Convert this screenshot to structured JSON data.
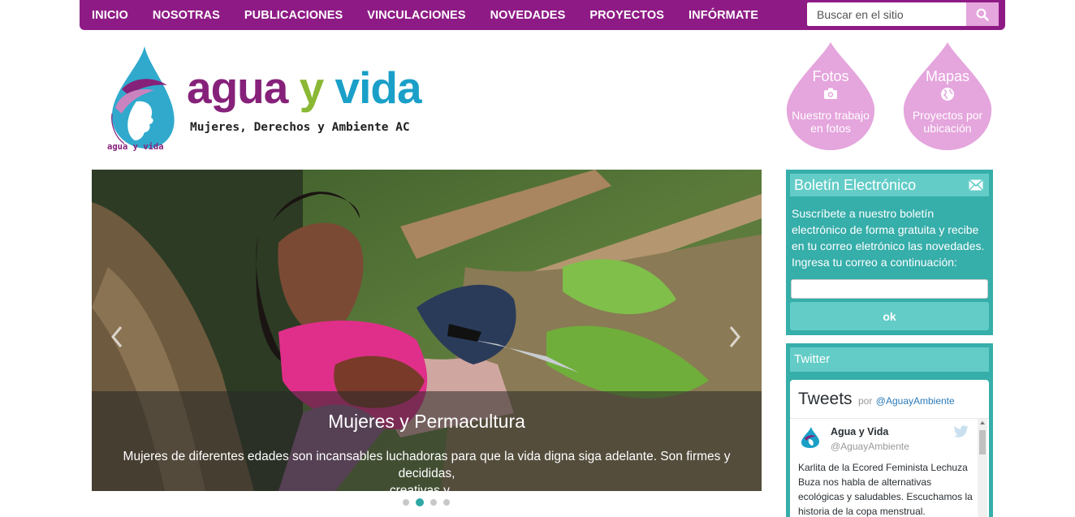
{
  "nav": {
    "items": [
      "INICIO",
      "NOSOTRAS",
      "PUBLICACIONES",
      "VINCULACIONES",
      "NOVEDADES",
      "PROYECTOS",
      "INFÓRMATE"
    ],
    "search_placeholder": "Buscar en el sitio",
    "accent": "#8e1b85"
  },
  "logo": {
    "word1": "agua",
    "word2": "y",
    "word3": "vida",
    "subtitle": "Mujeres, Derechos y Ambiente AC",
    "small": "agua y vida"
  },
  "drops": [
    {
      "title": "Fotos",
      "icon": "camera-icon",
      "desc_line1": "Nuestro trabajo",
      "desc_line2": "en fotos"
    },
    {
      "title": "Mapas",
      "icon": "globe-icon",
      "desc_line1": "Proyectos por",
      "desc_line2": "ubicación"
    }
  ],
  "carousel": {
    "title": "Mujeres y Permacultura",
    "text_line1": "Mujeres de diferentes edades son incansables luchadoras para que la vida digna siga adelante. Son firmes y decididas,",
    "text_line2": "creativas y ...",
    "slide_count": 4,
    "active_slide": 2
  },
  "newsletter": {
    "title": "Boletín Electrónico",
    "text": "Suscríbete a nuestro boletín electrónico de forma gratuita y recibe en tu correo eletrónico las novedades. Ingresa tu correo a continuación:",
    "button": "ok"
  },
  "twitter": {
    "title": "Twitter",
    "widget_title": "Tweets",
    "by": "por",
    "account": "@AguayAmbiente",
    "tweet": {
      "name": "Agua y Vida",
      "handle": "@AguayAmbiente",
      "text": "Karlita de la Ecored Feminista Lechuza Buza nos habla de alternativas ecológicas y saludables. Escuchamos la historia de la copa menstrual."
    }
  },
  "colors": {
    "purple": "#8e1b85",
    "pink": "#e5a5dd",
    "teal": "#36aeaa",
    "teal_light": "#63ccc7"
  }
}
